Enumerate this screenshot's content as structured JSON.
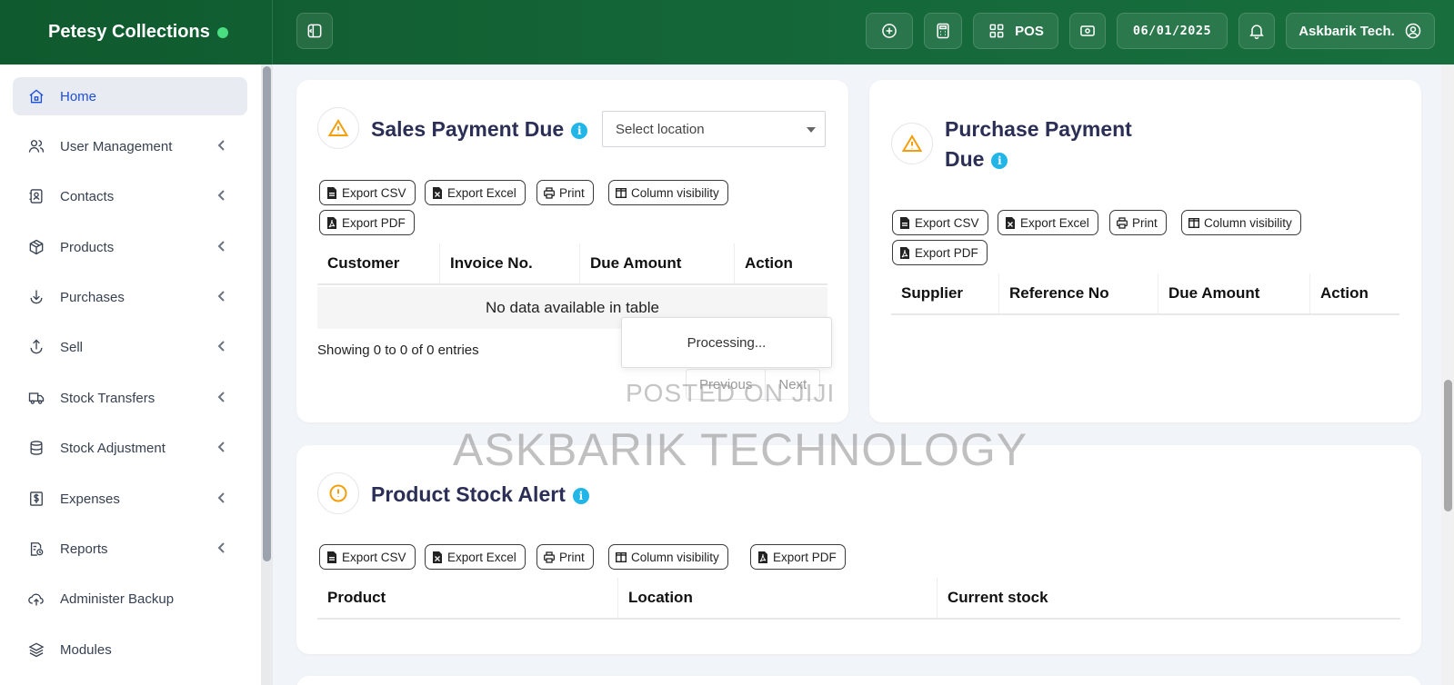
{
  "app": {
    "brand": "Petesy Collections",
    "accent": "#15683a",
    "online_color": "#4ade80"
  },
  "topbar": {
    "sidebar_toggle_icon": "sidebar-toggle-icon",
    "add_icon": "plus-circle-icon",
    "calculator_icon": "calculator-icon",
    "pos_label": "POS",
    "cash_icon": "cash-register-icon",
    "date": "06/01/2025",
    "notifications_icon": "bell-icon",
    "user_name": "Askbarik Tech."
  },
  "sidebar": {
    "items": [
      {
        "label": "Home",
        "icon": "home-icon",
        "active": true
      },
      {
        "label": "User Management",
        "icon": "users-icon"
      },
      {
        "label": "Contacts",
        "icon": "contacts-icon"
      },
      {
        "label": "Products",
        "icon": "box-icon"
      },
      {
        "label": "Purchases",
        "icon": "download-circle-icon"
      },
      {
        "label": "Sell",
        "icon": "upload-circle-icon"
      },
      {
        "label": "Stock Transfers",
        "icon": "truck-icon"
      },
      {
        "label": "Stock Adjustment",
        "icon": "database-icon"
      },
      {
        "label": "Expenses",
        "icon": "dollar-receipt-icon"
      },
      {
        "label": "Reports",
        "icon": "report-icon"
      },
      {
        "label": "Administer Backup",
        "icon": "cloud-upload-icon"
      },
      {
        "label": "Modules",
        "icon": "layers-icon"
      }
    ]
  },
  "buttons": {
    "export_csv": "Export CSV",
    "export_excel": "Export Excel",
    "print": "Print",
    "column_visibility": "Column visibility",
    "export_pdf": "Export PDF"
  },
  "sales_due": {
    "title": "Sales Payment Due",
    "select_placeholder": "Select location",
    "columns": [
      "Customer",
      "Invoice No.",
      "Due Amount",
      "Action"
    ],
    "empty_text": "No data available in table",
    "showing": "Showing 0 to 0 of 0 entries",
    "processing": "Processing...",
    "prev": "Previous",
    "next": "Next"
  },
  "purchase_due": {
    "title_line1": "Purchase Payment",
    "title_line2": "Due",
    "columns": [
      "Supplier",
      "Reference No",
      "Due Amount",
      "Action"
    ]
  },
  "stock_alert": {
    "title": "Product Stock Alert",
    "columns": [
      "Product",
      "Location",
      "Current stock"
    ]
  },
  "watermark": {
    "line1": "POSTED ON JIJI",
    "line2": "ASKBARIK TECHNOLOGY"
  }
}
